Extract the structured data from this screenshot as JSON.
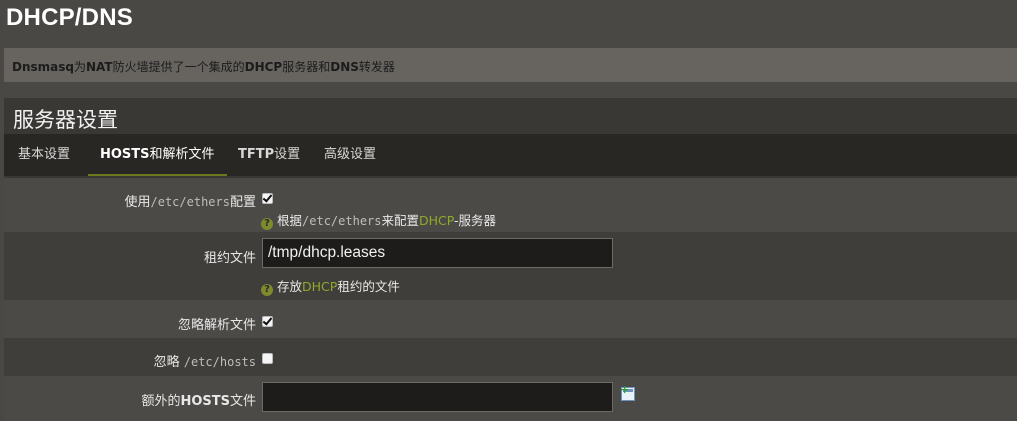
{
  "page": {
    "title": "DHCP/DNS",
    "description": {
      "part1": "Dnsmasq",
      "part2": "为",
      "part3": "NAT",
      "part4": "防火墙提供了一个集成的",
      "part5": "DHCP",
      "part6": "服务器和",
      "part7": "DNS",
      "part8": "转发器"
    }
  },
  "section": {
    "title": "服务器设置",
    "tabs": [
      {
        "label": "基本设置"
      },
      {
        "label_bold": "HOSTS",
        "label": "和解析文件",
        "active": true
      },
      {
        "label_bold": "TFTP",
        "label": "设置"
      },
      {
        "label": "高级设置"
      }
    ]
  },
  "fields": {
    "ethers": {
      "label_pre": "使用",
      "label_code": "/etc/ethers",
      "label_post": "配置",
      "checked": true,
      "help_pre": "根据",
      "help_code": "/etc/ethers",
      "help_mid": "来配置",
      "help_hl": "DHCP",
      "help_post": "-服务器"
    },
    "leasefile": {
      "label": "租约文件",
      "value": "/tmp/dhcp.leases",
      "help_pre": "存放",
      "help_hl": "DHCP",
      "help_post": "租约的文件"
    },
    "noresolv": {
      "label": "忽略解析文件",
      "checked": true
    },
    "nohosts": {
      "label_pre": "忽略 ",
      "label_code": "/etc/hosts",
      "checked": false
    },
    "addnhosts": {
      "label_pre": "额外的",
      "label_bold": "HOSTS",
      "label_post": "文件",
      "value": "",
      "add_icon": "add-field-icon"
    }
  },
  "colors": {
    "accent": "#6b7a1e",
    "help_highlight": "#8fa92a"
  }
}
